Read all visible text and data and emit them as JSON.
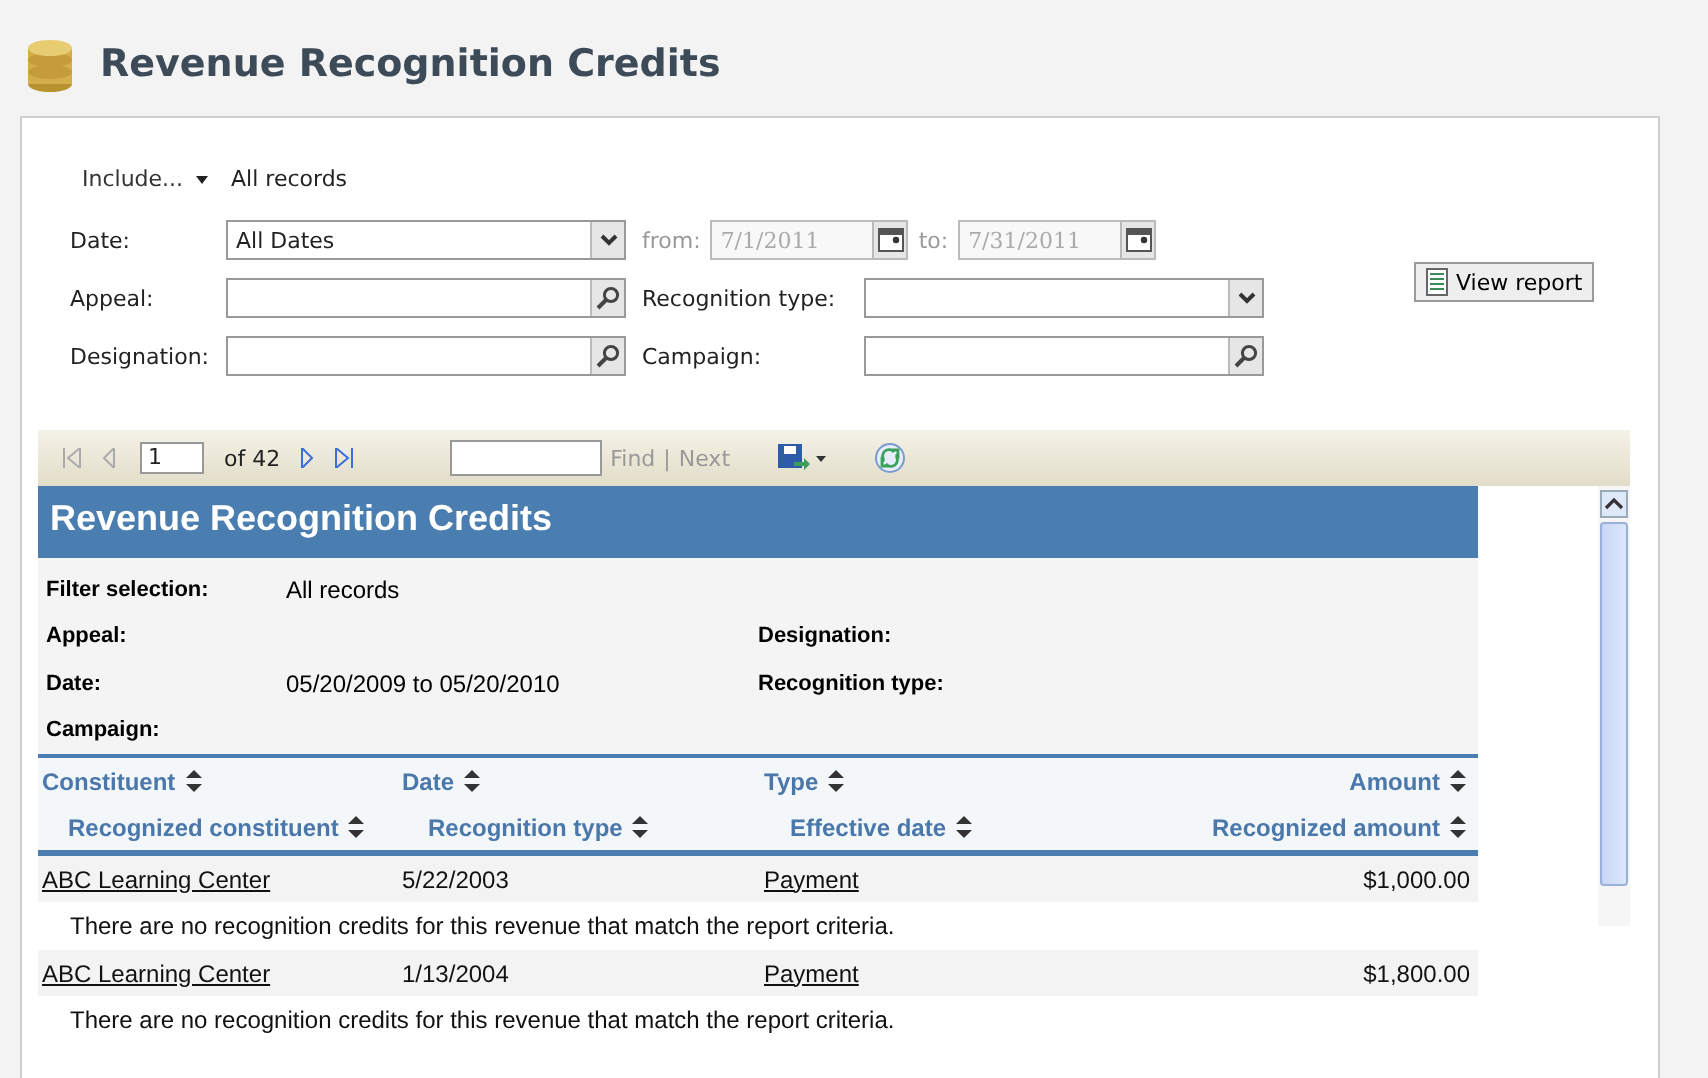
{
  "page": {
    "title": "Revenue Recognition Credits"
  },
  "filters": {
    "include_label": "Include...",
    "include_value": "All records",
    "date": {
      "label": "Date:",
      "value": "All Dates",
      "from_label": "from:",
      "from": "7/1/2011",
      "to_label": "to:",
      "to": "7/31/2011",
      "range_disabled": true
    },
    "appeal": {
      "label": "Appeal:"
    },
    "recognition_type": {
      "label": "Recognition type:"
    },
    "designation": {
      "label": "Designation:"
    },
    "campaign": {
      "label": "Campaign:"
    },
    "view_report": "View report"
  },
  "toolbar": {
    "page": "1",
    "page_count": "of 42",
    "find": "Find",
    "separator": "|",
    "next": "Next"
  },
  "report": {
    "title": "Revenue Recognition Credits",
    "filter_selection": {
      "label": "Filter selection:",
      "value": "All records"
    },
    "criteria_left": [
      {
        "label": "Appeal:"
      },
      {
        "label": "Date:",
        "value": "05/20/2009 to 05/20/2010"
      },
      {
        "label": "Campaign:"
      }
    ],
    "criteria_right": [
      {
        "label": "Designation:"
      },
      {
        "label": "Recognition type:"
      }
    ],
    "header_row_1": [
      "Constituent",
      "Date",
      "Type",
      "Amount"
    ],
    "header_row_2": [
      "Recognized constituent",
      "Recognition type",
      "Effective date",
      "Recognized amount"
    ],
    "rows": [
      {
        "constituent": "ABC Learning Center",
        "date": "5/22/2003",
        "type": "Payment",
        "amount": "$1,000.00",
        "message": "There are no recognition credits for this revenue that match the report criteria."
      },
      {
        "constituent": "ABC Learning Center",
        "date": "1/13/2004",
        "type": "Payment",
        "amount": "$1,800.00",
        "message": "There are no recognition credits for this revenue that match the report criteria."
      }
    ]
  }
}
